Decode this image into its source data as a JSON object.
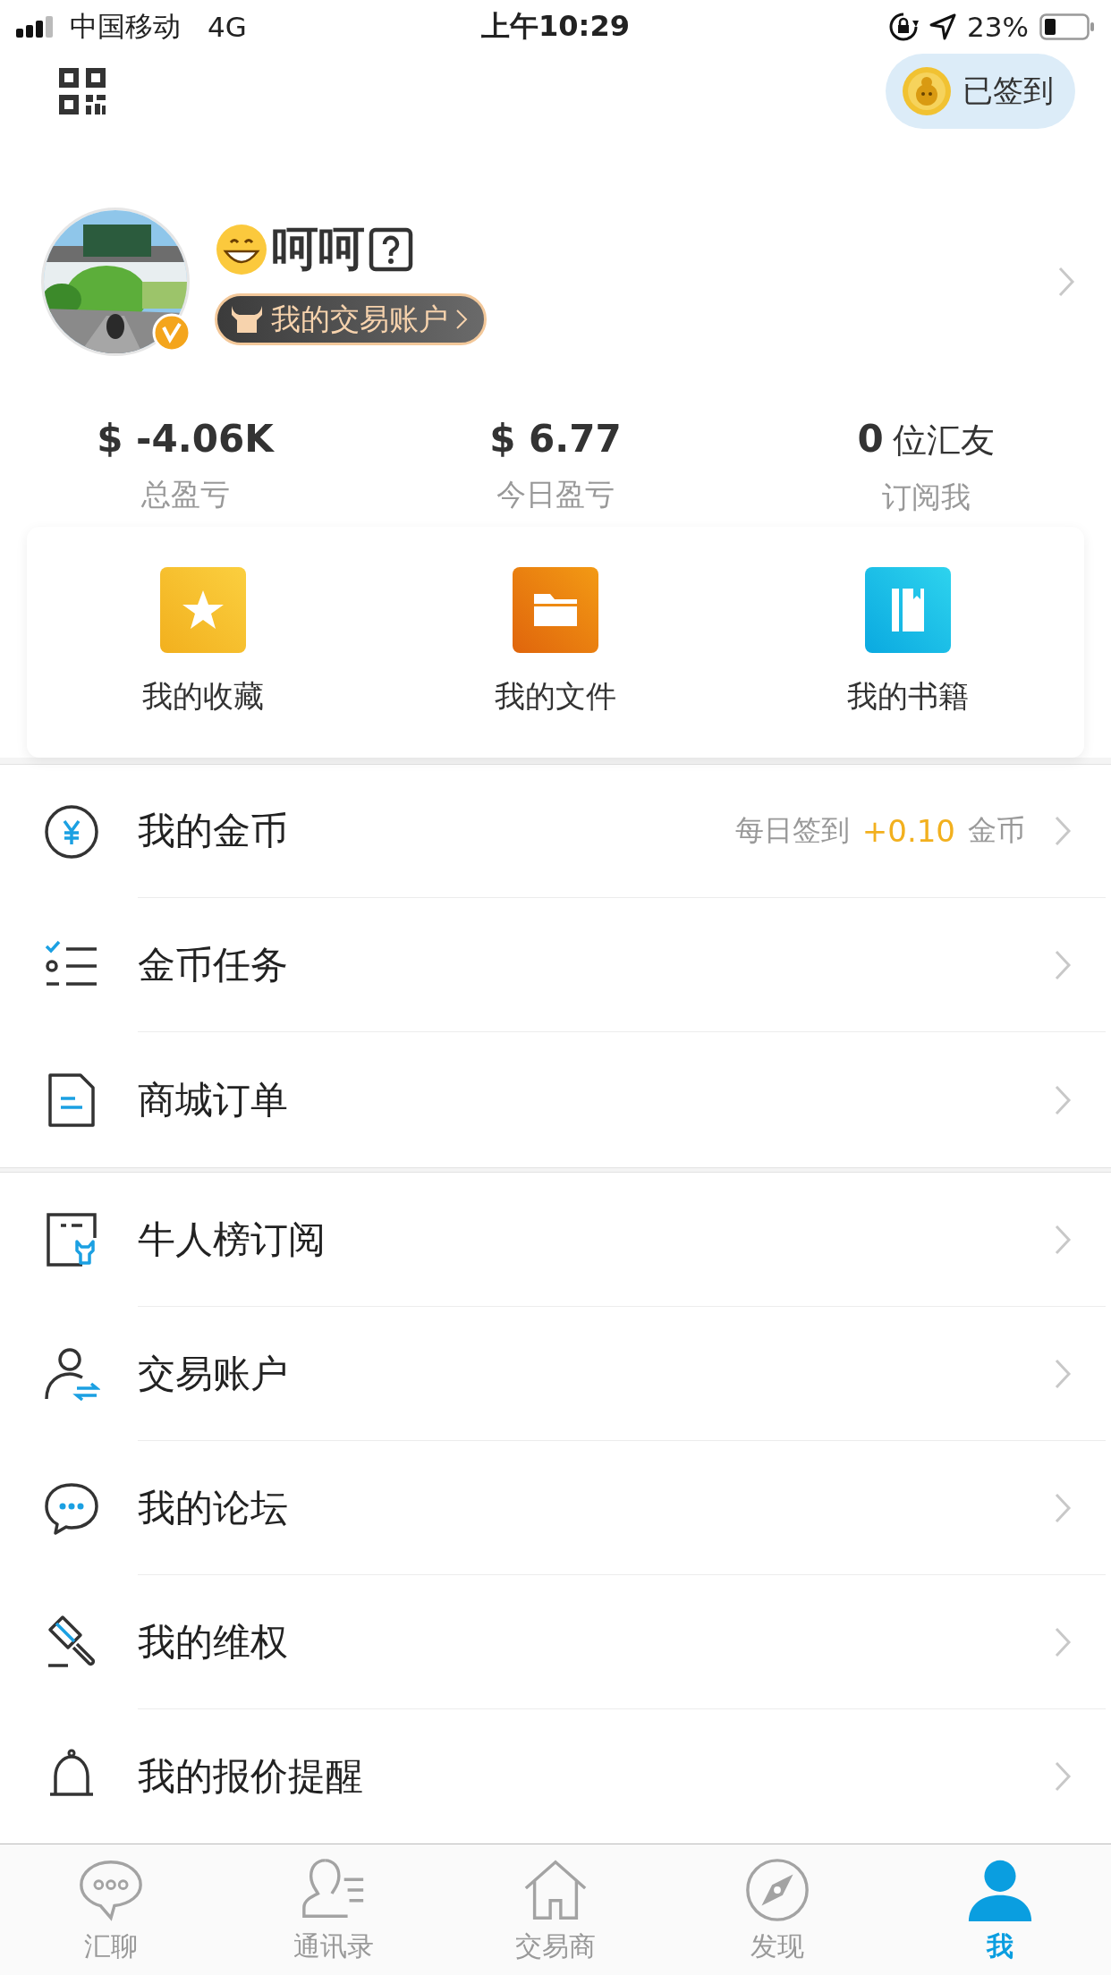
{
  "status_bar": {
    "carrier": "中国移动",
    "network": "4G",
    "time": "上午10:29",
    "battery": "23%"
  },
  "header": {
    "signin": "已签到"
  },
  "profile": {
    "name": "呵呵",
    "account_link": "我的交易账户",
    "verified": true
  },
  "stats": [
    {
      "value": "$ -4.06K",
      "label": "总盈亏"
    },
    {
      "value": "$ 6.77",
      "label": "今日盈亏"
    },
    {
      "value": "0",
      "unit": "位汇友",
      "label": "订阅我"
    }
  ],
  "shortcuts": [
    {
      "label": "我的收藏",
      "kind": "star"
    },
    {
      "label": "我的文件",
      "kind": "folder"
    },
    {
      "label": "我的书籍",
      "kind": "book"
    }
  ],
  "menu_groups": [
    [
      {
        "label": "我的金币",
        "kind": "coin",
        "note": "每日签到",
        "bonus": "+0.10",
        "bonus_unit": "金币"
      },
      {
        "label": "金币任务",
        "kind": "tasks"
      },
      {
        "label": "商城订单",
        "kind": "order"
      }
    ],
    [
      {
        "label": "牛人榜订阅",
        "kind": "ranking"
      },
      {
        "label": "交易账户",
        "kind": "account"
      },
      {
        "label": "我的论坛",
        "kind": "forum"
      },
      {
        "label": "我的维权",
        "kind": "gavel"
      },
      {
        "label": "我的报价提醒",
        "kind": "bell"
      }
    ]
  ],
  "tabs": [
    {
      "label": "汇聊",
      "kind": "chat",
      "selected": false
    },
    {
      "label": "通讯录",
      "kind": "contacts",
      "selected": false
    },
    {
      "label": "交易商",
      "kind": "home",
      "selected": false
    },
    {
      "label": "发现",
      "kind": "compass",
      "selected": false
    },
    {
      "label": "我",
      "kind": "me",
      "selected": true
    }
  ]
}
